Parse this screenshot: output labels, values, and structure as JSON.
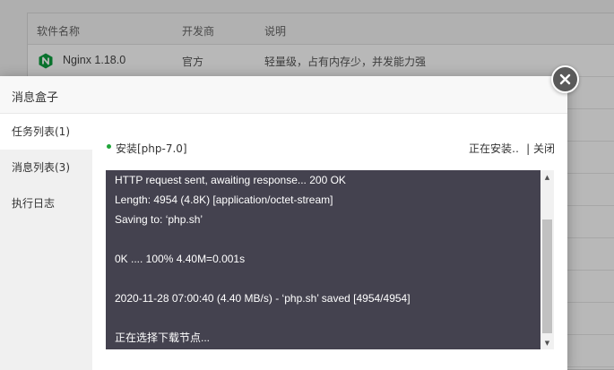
{
  "background_table": {
    "headers": [
      "软件名称",
      "开发商",
      "说明"
    ],
    "rows": [
      {
        "name": "Nginx 1.18.0",
        "vendor": "官方",
        "desc": "轻量级，占有内存少，并发能力强"
      }
    ]
  },
  "modal": {
    "title": "消息盒子",
    "sidebar": [
      {
        "label": "任务列表(1)",
        "active": true
      },
      {
        "label": "消息列表(3)",
        "active": false
      },
      {
        "label": "执行日志",
        "active": false
      }
    ],
    "task": {
      "name": "安装[php-7.0]",
      "status": "正在安装‥",
      "close_label": "| 关闭"
    },
    "console_lines": [
      "HTTP request sent, awaiting response... 200 OK",
      "Length: 4954 (4.8K) [application/octet-stream]",
      "Saving to: ‘php.sh’",
      "",
      "0K .... 100% 4.40M=0.001s",
      "",
      "2020-11-28 07:00:40 (4.40 MB/s) - ‘php.sh’ saved [4954/4954]",
      "",
      "正在选择下载节点..."
    ]
  },
  "colors": {
    "accent_green": "#20a53a",
    "console_bg": "#44424f",
    "close_bg": "#5a5a5a"
  },
  "icons": {
    "close": "close-icon",
    "nginx": "nginx-logo-icon",
    "status_dot": "status-dot-icon"
  }
}
